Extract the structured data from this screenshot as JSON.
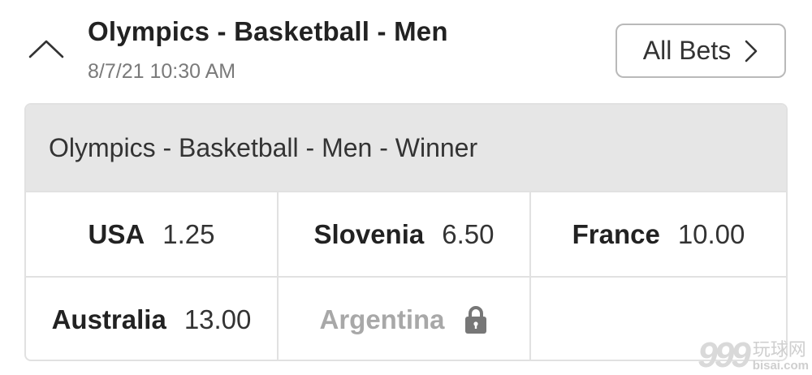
{
  "header": {
    "title": "Olympics - Basketball - Men",
    "datetime": "8/7/21 10:30 AM",
    "collapse_icon": "chevron-up-icon",
    "all_bets_label": "All Bets",
    "all_bets_icon": "chevron-right-icon"
  },
  "market": {
    "title": "Olympics - Basketball - Men - Winner",
    "selections": [
      {
        "name": "USA",
        "odds": "1.25",
        "locked": false
      },
      {
        "name": "Slovenia",
        "odds": "6.50",
        "locked": false
      },
      {
        "name": "France",
        "odds": "10.00",
        "locked": false
      },
      {
        "name": "Australia",
        "odds": "13.00",
        "locked": false
      },
      {
        "name": "Argentina",
        "odds": "",
        "locked": true,
        "icon": "lock-icon"
      }
    ]
  },
  "watermark": {
    "number": "999",
    "cn_text": "玩球网",
    "url": "bisai.com"
  },
  "colors": {
    "market_header_bg": "#e6e6e6",
    "border": "#e1e1e1",
    "locked_text": "#a8a8a8",
    "muted_text": "#7a7a7a"
  }
}
